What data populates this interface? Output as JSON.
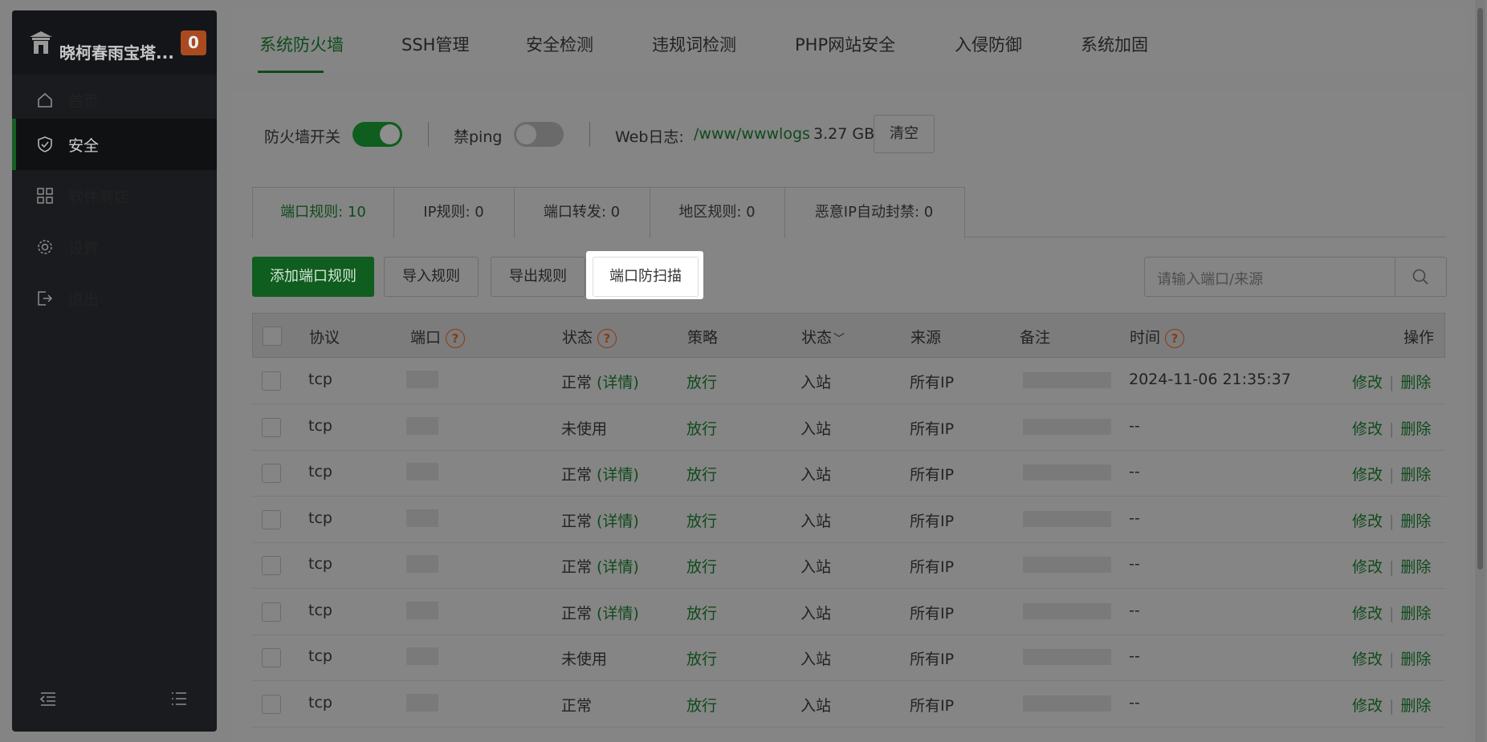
{
  "sidebar": {
    "brand_title": "晓柯春雨宝塔...",
    "badge": "0",
    "items": [
      {
        "label": "首页",
        "icon": "home-icon"
      },
      {
        "label": "安全",
        "icon": "shield-icon",
        "active": true
      },
      {
        "label": "软件商店",
        "icon": "grid-icon"
      },
      {
        "label": "设置",
        "icon": "gear-icon"
      },
      {
        "label": "退出",
        "icon": "logout-icon"
      }
    ]
  },
  "tabs": [
    "系统防火墙",
    "SSH管理",
    "安全检测",
    "违规词检测",
    "PHP网站安全",
    "入侵防御",
    "系统加固"
  ],
  "firewall": {
    "switch_label": "防火墙开关",
    "switch_on": true,
    "ping_label": "禁ping",
    "ping_on": false,
    "weblog_label": "Web日志:",
    "weblog_path": "/www/wwwlogs",
    "weblog_size": "3.27 GB",
    "clear_label": "清空"
  },
  "subtabs": [
    "端口规则: 10",
    "IP规则: 0",
    "端口转发: 0",
    "地区规则: 0",
    "恶意IP自动封禁: 0"
  ],
  "actions": {
    "add_rule": "添加端口规则",
    "import_rule": "导入规则",
    "export_rule": "导出规则",
    "anti_scan": "端口防扫描",
    "search_placeholder": "请输入端口/来源"
  },
  "table": {
    "headers": {
      "protocol": "协议",
      "port": "端口",
      "status": "状态",
      "policy": "策略",
      "direction": "状态",
      "source": "来源",
      "remark": "备注",
      "time": "时间",
      "ops": "操作"
    },
    "rows": [
      {
        "protocol": "tcp",
        "status": "正常",
        "detail": "(详情)",
        "policy": "放行",
        "direction": "入站",
        "source": "所有IP",
        "time": "2024-11-06 21:35:37",
        "edit": "修改",
        "delete": "删除"
      },
      {
        "protocol": "tcp",
        "status": "未使用",
        "detail": "",
        "policy": "放行",
        "direction": "入站",
        "source": "所有IP",
        "time": "--",
        "edit": "修改",
        "delete": "删除"
      },
      {
        "protocol": "tcp",
        "status": "正常",
        "detail": "(详情)",
        "policy": "放行",
        "direction": "入站",
        "source": "所有IP",
        "time": "--",
        "edit": "修改",
        "delete": "删除"
      },
      {
        "protocol": "tcp",
        "status": "正常",
        "detail": "(详情)",
        "policy": "放行",
        "direction": "入站",
        "source": "所有IP",
        "time": "--",
        "edit": "修改",
        "delete": "删除"
      },
      {
        "protocol": "tcp",
        "status": "正常",
        "detail": "(详情)",
        "policy": "放行",
        "direction": "入站",
        "source": "所有IP",
        "time": "--",
        "edit": "修改",
        "delete": "删除"
      },
      {
        "protocol": "tcp",
        "status": "正常",
        "detail": "(详情)",
        "policy": "放行",
        "direction": "入站",
        "source": "所有IP",
        "time": "--",
        "edit": "修改",
        "delete": "删除"
      },
      {
        "protocol": "tcp",
        "status": "未使用",
        "detail": "",
        "policy": "放行",
        "direction": "入站",
        "source": "所有IP",
        "time": "--",
        "edit": "修改",
        "delete": "删除"
      },
      {
        "protocol": "tcp",
        "status": "正常",
        "detail": "",
        "policy": "放行",
        "direction": "入站",
        "source": "所有IP",
        "time": "--",
        "edit": "修改",
        "delete": "删除"
      }
    ]
  },
  "colors": {
    "accent": "#20a53a",
    "overlay": "#848484",
    "sidebar": "#191b1e"
  }
}
